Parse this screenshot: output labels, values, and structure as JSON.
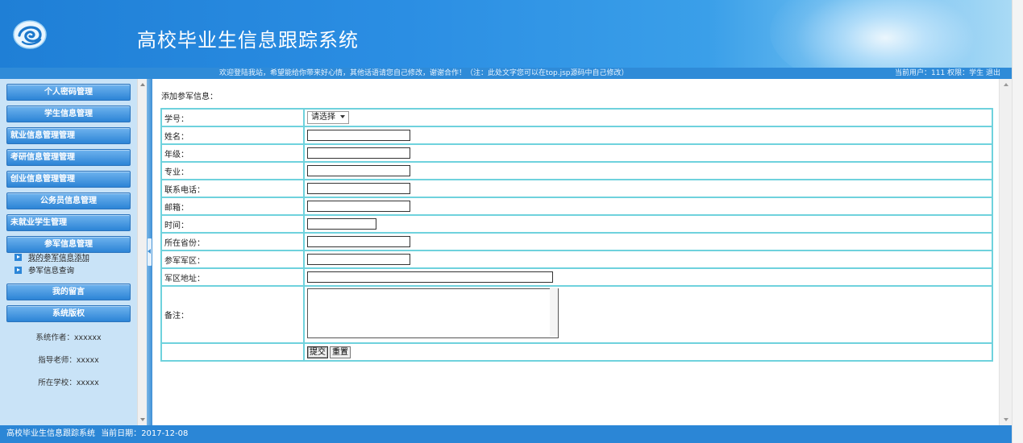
{
  "header": {
    "site_title": "高校毕业生信息跟踪系统",
    "logo_icon": "swirl-logo-icon"
  },
  "notice_bar": {
    "notice": "欢迎登陆我站，希望能给你带来好心情，其他话语请您自己修改，谢谢合作！（注：此处文字您可以在top.jsp源码中自己修改）",
    "current_user_label": "当前用户：",
    "current_user": "111",
    "role_label": "权限：",
    "role": "学生",
    "logout": "退出"
  },
  "sidebar": {
    "menu": [
      {
        "label": "个人密码管理"
      },
      {
        "label": "学生信息管理"
      },
      {
        "label": "就业信息管理管理"
      },
      {
        "label": "考研信息管理管理"
      },
      {
        "label": "创业信息管理管理"
      },
      {
        "label": "公务员信息管理"
      },
      {
        "label": "未就业学生管理"
      },
      {
        "label": "参军信息管理"
      },
      {
        "label": "我的留言"
      },
      {
        "label": "系统版权"
      }
    ],
    "sub_items": [
      {
        "label": "我的参军信息添加"
      },
      {
        "label": "参军信息查询"
      }
    ],
    "info": {
      "author": "系统作者：xxxxxx",
      "teacher": "指导老师：xxxxx",
      "school": "所在学校：xxxxx"
    }
  },
  "form": {
    "title": "添加参军信息：",
    "fields": {
      "student_id": {
        "label": "学号：",
        "selected": "请选择"
      },
      "name": {
        "label": "姓名：",
        "value": ""
      },
      "grade": {
        "label": "年级：",
        "value": ""
      },
      "major": {
        "label": "专业：",
        "value": ""
      },
      "phone": {
        "label": "联系电话：",
        "value": ""
      },
      "email": {
        "label": "邮箱：",
        "value": ""
      },
      "time": {
        "label": "时间：",
        "value": ""
      },
      "province": {
        "label": "所在省份：",
        "value": ""
      },
      "military_region": {
        "label": "参军军区：",
        "value": ""
      },
      "region_address": {
        "label": "军区地址：",
        "value": ""
      },
      "remark": {
        "label": "备注：",
        "value": ""
      }
    },
    "submit_label": "提交",
    "reset_label": "重置"
  },
  "footer": {
    "system_name": "高校毕业生信息跟踪系统",
    "date_label": "当前日期：",
    "date": "2017-12-08"
  },
  "colors": {
    "header_blue": "#2b8ee3",
    "sidebar_bg": "#c9e3f7",
    "table_border": "#6fd2dd",
    "footer_blue": "#2b86d6"
  }
}
